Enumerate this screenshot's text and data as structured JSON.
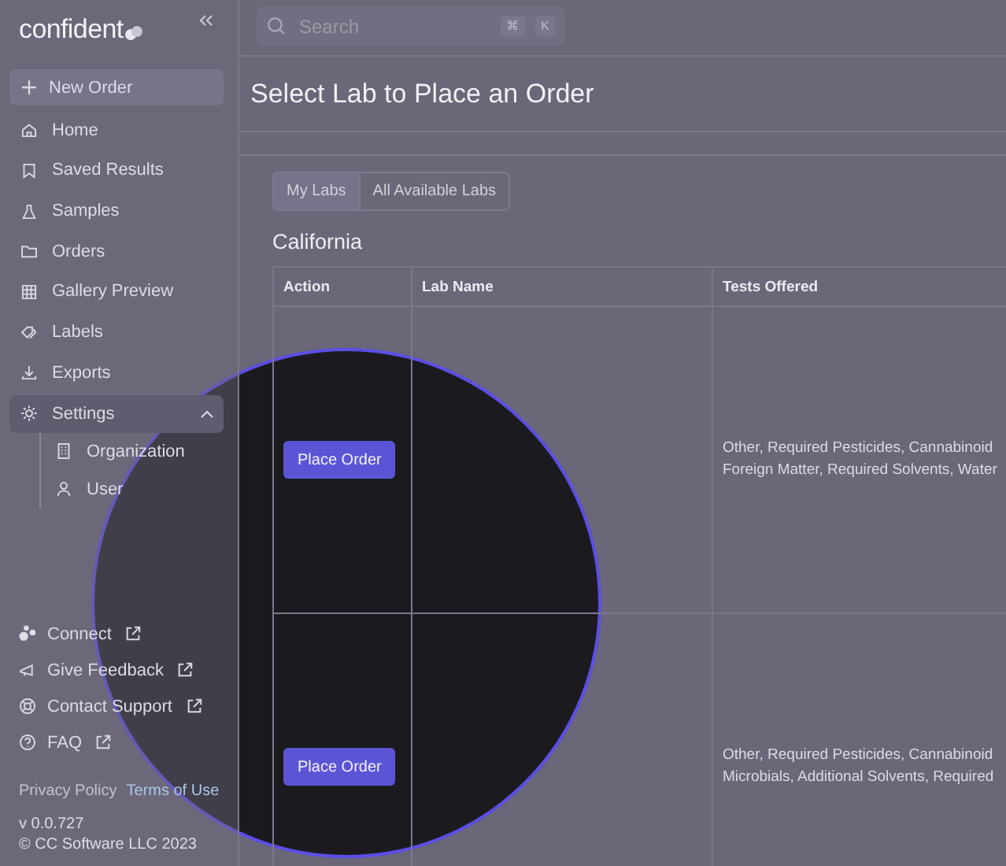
{
  "sidebar": {
    "logo": "confident",
    "new_order": {
      "label": "New Order"
    },
    "items": [
      {
        "label": "Home",
        "selected": false
      },
      {
        "label": "Saved Results",
        "selected": false
      },
      {
        "label": "Samples",
        "selected": false
      },
      {
        "label": "Orders",
        "selected": false
      },
      {
        "label": "Gallery Preview",
        "selected": false
      },
      {
        "label": "Labels",
        "selected": false
      },
      {
        "label": "Exports",
        "selected": false
      },
      {
        "label": "Settings",
        "selected": true,
        "expanded": true,
        "children": [
          {
            "label": "Organization"
          },
          {
            "label": "User"
          }
        ]
      }
    ],
    "footer_links": [
      {
        "label": "Connect"
      },
      {
        "label": "Give Feedback"
      },
      {
        "label": "Contact Support"
      },
      {
        "label": "FAQ"
      }
    ],
    "legal_links": [
      "Privacy Policy",
      "Terms of Use"
    ],
    "version": "v 0.0.727",
    "copyright": "© CC Software LLC 2023"
  },
  "search": {
    "placeholder": "Search",
    "shortcut": [
      "⌘",
      "K"
    ]
  },
  "title": "Select Lab to Place an Order",
  "tabs": [
    {
      "label": "My Labs",
      "selected": true
    },
    {
      "label": "All Available Labs",
      "selected": false
    }
  ],
  "section": "California",
  "table": {
    "columns": [
      "Action",
      "Lab Name",
      "Tests Offered"
    ],
    "rows": [
      {
        "action": "Place Order",
        "tests": [
          "Other, Required Pesticides, Cannabinoid",
          "Foreign Matter, Required Solvents, Water"
        ]
      },
      {
        "action": "Place Order",
        "tests": [
          "Other, Required Pesticides, Cannabinoid",
          "Microbials, Additional Solvents, Required"
        ]
      }
    ]
  },
  "spotlight": {
    "kind": "circle"
  }
}
